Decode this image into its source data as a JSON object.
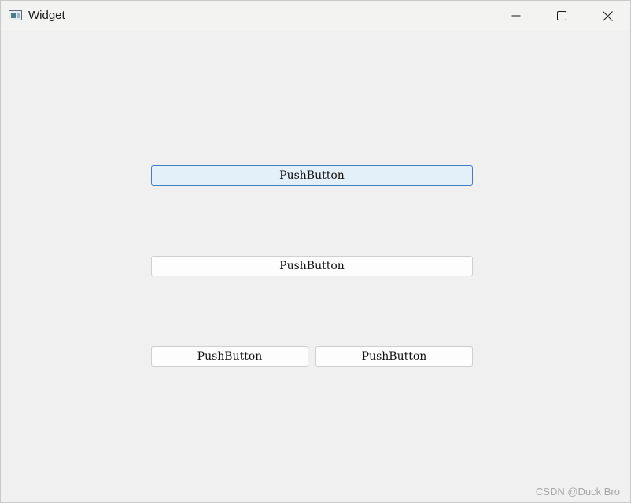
{
  "window": {
    "title": "Widget",
    "icon": "app-window-icon",
    "controls": {
      "minimize_icon": "minimize-icon",
      "maximize_icon": "maximize-icon",
      "close_icon": "close-icon"
    }
  },
  "buttons": [
    {
      "label": "PushButton",
      "state": "focused"
    },
    {
      "label": "PushButton",
      "state": "normal"
    },
    {
      "label": "PushButton",
      "state": "normal"
    },
    {
      "label": "PushButton",
      "state": "normal"
    }
  ],
  "watermark": "CSDN @Duck Bro",
  "colors": {
    "window_bg": "#f0f0f0",
    "titlebar_bg": "#f3f3f1",
    "focus_border": "#3d7fbf",
    "focus_bg": "#e3eff9"
  }
}
